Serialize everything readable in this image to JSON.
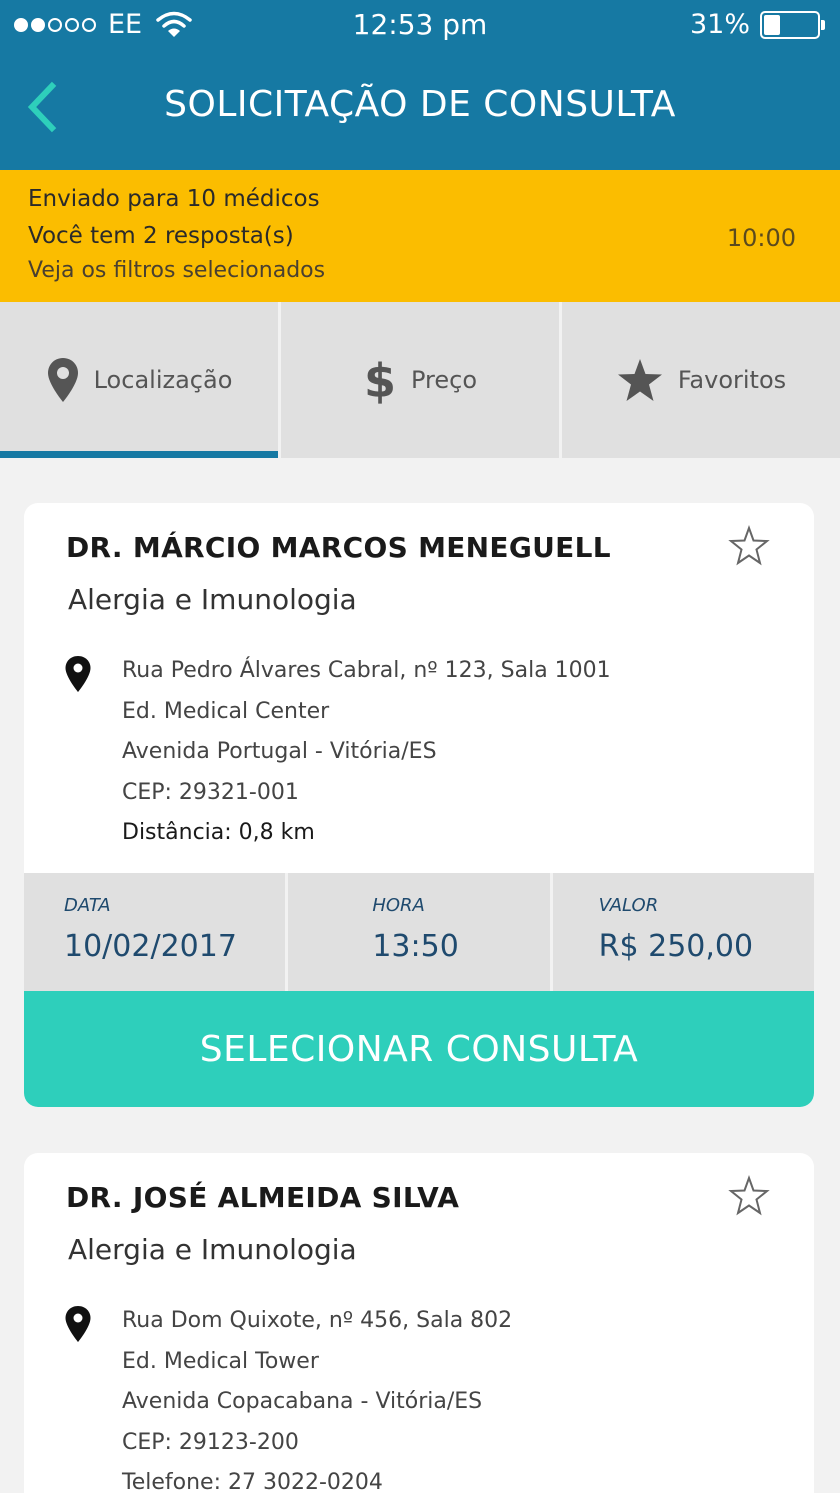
{
  "status_bar": {
    "carrier": "EE",
    "time": "12:53 pm",
    "battery": "31%",
    "battery_level": 0.31
  },
  "header": {
    "title": "SOLICITAÇÃO DE CONSULTA"
  },
  "banner": {
    "sent": "Enviado para 10 médicos",
    "responses": "Você tem 2 resposta(s)",
    "filters_link": "Veja os filtros selecionados",
    "timer": "10:00"
  },
  "tabs": [
    {
      "label": "Localização",
      "icon": "location-pin-icon",
      "active": true
    },
    {
      "label": "Preço",
      "icon": "dollar-icon",
      "active": false
    },
    {
      "label": "Favoritos",
      "icon": "star-icon",
      "active": false
    }
  ],
  "doctors": [
    {
      "name": "DR. MÁRCIO MARCOS MENEGUELL",
      "specialty": "Alergia e Imunologia",
      "address": [
        "Rua Pedro Álvares Cabral, nº 123, Sala 1001",
        "Ed. Medical Center",
        "Avenida Portugal - Vitória/ES",
        "CEP: 29321-001"
      ],
      "distance": "Distância: 0,8 km",
      "date_label": "DATA",
      "date": "10/02/2017",
      "time_label": "HORA",
      "time": "13:50",
      "value_label": "VALOR",
      "value": "R$ 250,00",
      "select_label": "SELECIONAR CONSULTA"
    },
    {
      "name": "DR. JOSÉ ALMEIDA SILVA",
      "specialty": "Alergia e Imunologia",
      "address": [
        "Rua Dom Quixote, nº 456, Sala 802",
        "Ed. Medical Tower",
        "Avenida Copacabana - Vitória/ES",
        "CEP: 29123-200",
        "Telefone: 27 3022-0204"
      ]
    }
  ],
  "colors": {
    "header": "#1679a3",
    "banner": "#fbbd00",
    "accent": "#2ecfbb",
    "back_arrow": "#2ecfbb"
  }
}
